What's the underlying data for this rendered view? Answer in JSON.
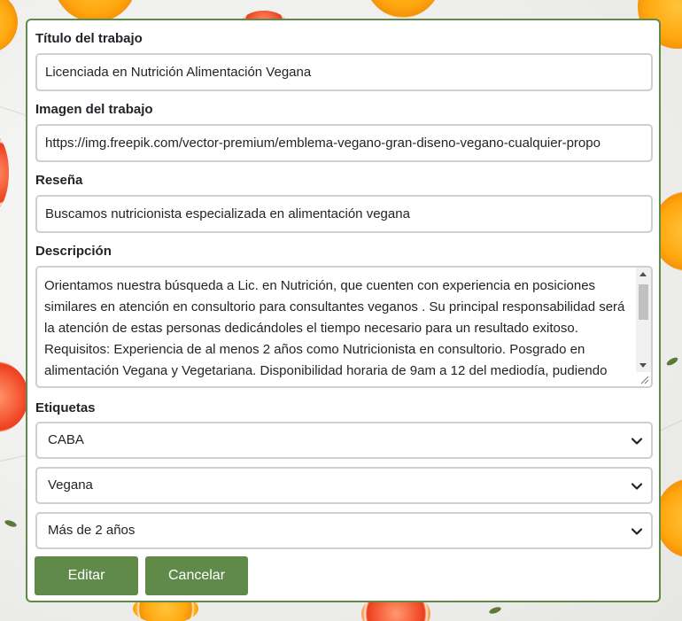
{
  "form": {
    "title": {
      "label": "Título del trabajo",
      "value": "Licenciada en Nutrición Alimentación Vegana"
    },
    "image": {
      "label": "Imagen del trabajo",
      "value": "https://img.freepik.com/vector-premium/emblema-vegano-gran-diseno-vegano-cualquier-propo"
    },
    "review": {
      "label": "Reseña",
      "value": "Buscamos nutricionista especializada en alimentación vegana"
    },
    "description": {
      "label": "Descripción",
      "value": "Orientamos nuestra búsqueda a Lic. en Nutrición, que cuenten con experiencia en posiciones similares en atención en consultorio para consultantes veganos . Su principal responsabilidad será la atención de estas personas dedicándoles el tiempo necesario para un resultado exitoso. Requisitos: Experiencia de al menos 2 años como Nutricionista en consultorio. Posgrado en alimentación Vegana y Vegetariana. Disponibilidad horaria de 9am a 12 del mediodía, pudiendo trabajar Lunes a Viernes. Zona de trabajo: CABA. Buena comunicación."
    },
    "tags": {
      "label": "Etiquetas",
      "selects": [
        {
          "value": "CABA"
        },
        {
          "value": "Vegana"
        },
        {
          "value": "Más de 2 años"
        }
      ]
    },
    "buttons": {
      "edit": "Editar",
      "cancel": "Cancelar"
    }
  },
  "colors": {
    "accent": "#5f8a4a",
    "border": "#cfcfcf",
    "text": "#212529"
  },
  "icons": [
    "chevron-down-icon",
    "resize-grip-icon"
  ]
}
